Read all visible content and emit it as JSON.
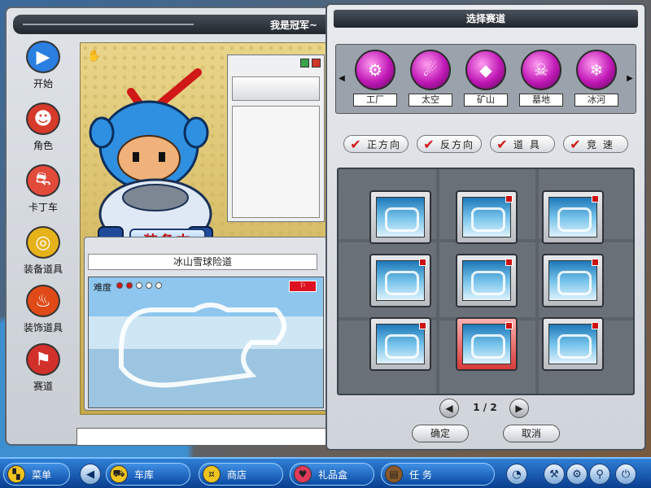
{
  "main_window": {
    "title": "我是冠军~"
  },
  "sidebar": {
    "items": [
      {
        "label": "开始",
        "icon": "play-icon",
        "color": "#2a7fe0"
      },
      {
        "label": "角色",
        "icon": "character-icon",
        "color": "#d63a2a"
      },
      {
        "label": "卡丁车",
        "icon": "kart-icon",
        "color": "#e24a3a"
      },
      {
        "label": "装备道具",
        "icon": "goggles-icon",
        "color": "#e6b21a"
      },
      {
        "label": "装饰道具",
        "icon": "flame-shirt-icon",
        "color": "#e04a18"
      },
      {
        "label": "赛道",
        "icon": "track-flag-icon",
        "color": "#d2302a"
      }
    ]
  },
  "preview": {
    "equip_badge": "装备中",
    "track_name": "冰山雪球险道",
    "difficulty_label": "难度",
    "difficulty": {
      "filled": 2,
      "total": 5
    }
  },
  "track_window": {
    "title": "选择赛道",
    "categories": [
      {
        "label": "工厂",
        "icon": "gear-icon"
      },
      {
        "label": "太空",
        "icon": "ufo-icon"
      },
      {
        "label": "矿山",
        "icon": "diamond-icon"
      },
      {
        "label": "墓地",
        "icon": "skull-icon"
      },
      {
        "label": "冰河",
        "icon": "snowflake-icon"
      }
    ],
    "filters": [
      {
        "label": "正方向",
        "checked": true
      },
      {
        "label": "反方向",
        "checked": true
      },
      {
        "label": "道 具",
        "checked": true
      },
      {
        "label": "竞 速",
        "checked": true
      }
    ],
    "thumbnails": [
      {
        "selected": false
      },
      {
        "selected": false
      },
      {
        "selected": false
      },
      {
        "selected": false
      },
      {
        "selected": false
      },
      {
        "selected": false
      },
      {
        "selected": false
      },
      {
        "selected": true
      },
      {
        "selected": false
      }
    ],
    "pager": {
      "current": "1",
      "total": "2",
      "text": "1 / 2"
    },
    "confirm_label": "确定",
    "cancel_label": "取消"
  },
  "taskbar": {
    "menu_label": "菜单",
    "garage_label": "车库",
    "shop_label": "商店",
    "giftbox_label": "礼品盒",
    "task_label": "任    务"
  }
}
